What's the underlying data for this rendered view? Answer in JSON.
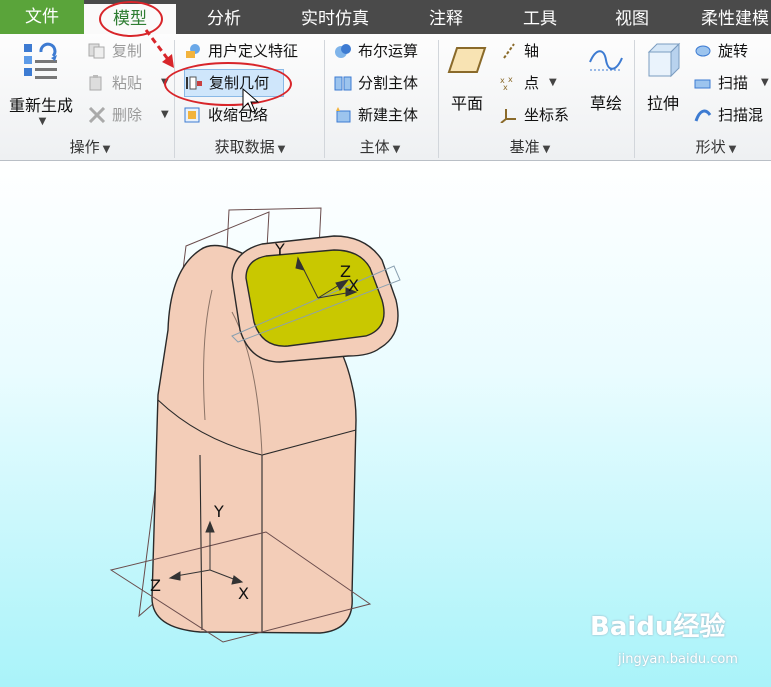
{
  "tabs": [
    "文件",
    "模型",
    "分析",
    "实时仿真",
    "注释",
    "工具",
    "视图",
    "柔性建模"
  ],
  "groups": {
    "operation": {
      "regenerate": "重新生成",
      "copy": "复制",
      "paste": "粘贴",
      "delete": "删除",
      "footer": "操作"
    },
    "get_data": {
      "udf": "用户定义特征",
      "copy_geometry": "复制几何",
      "shrinkwrap": "收缩包络",
      "footer": "获取数据"
    },
    "body": {
      "boolean": "布尔运算",
      "split_body": "分割主体",
      "new_body": "新建主体",
      "footer": "主体"
    },
    "datum": {
      "plane": "平面",
      "axis": "轴",
      "point": "点",
      "csys": "坐标系",
      "sketch": "草绘",
      "footer": "基准"
    },
    "shapes": {
      "extrude": "拉伸",
      "revolve": "旋转",
      "sweep": "扫描",
      "swept_blend": "扫描混",
      "footer": "形状"
    }
  },
  "axes": {
    "y": "Y",
    "z": "Z",
    "x": "X"
  },
  "watermark": {
    "brand": "Baidu经验",
    "url": "jingyan.baidu.com"
  },
  "colors": {
    "file_tab": "#5aa43a",
    "highlight_red": "#d8252a",
    "face_yellow": "#c9c800",
    "part_skin": "#f3cdb8"
  }
}
